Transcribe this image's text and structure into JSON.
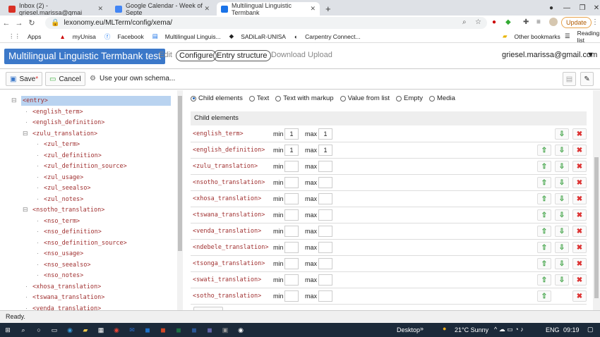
{
  "browser": {
    "tabs": [
      {
        "title": "Inbox (2) - griesel.marissa@gmai",
        "color": "#d93025"
      },
      {
        "title": "Google Calendar - Week of Septe",
        "color": "#4285f4"
      },
      {
        "title": "Multilingual Linguistic Termbank",
        "color": "#1a73e8"
      }
    ],
    "url": "lexonomy.eu/MLTerm/config/xema/",
    "update_label": "Update",
    "bookmarks": [
      "Apps",
      "myUnisa",
      "Facebook",
      "Multilingual Linguis...",
      "SADiLaR-UNISA",
      "Carpentry Connect..."
    ],
    "other_bookmarks": "Other bookmarks",
    "reading_list": "Reading list"
  },
  "app": {
    "title": "Multilingual Linguistic Termbank test",
    "menu": [
      "Edit",
      "Configure",
      "Entry structure",
      "Download",
      "Upload"
    ],
    "user": "griesel.marissa@gmail.com"
  },
  "toolbar": {
    "save": "Save",
    "cancel": "Cancel",
    "schema": "Use your own schema..."
  },
  "tree": [
    {
      "label": "<entry>",
      "depth": 0,
      "toggle": "−",
      "selected": true
    },
    {
      "label": "<english_term>",
      "depth": 1
    },
    {
      "label": "<english_definition>",
      "depth": 1
    },
    {
      "label": "<zulu_translation>",
      "depth": 1,
      "toggle": "−"
    },
    {
      "label": "<zul_term>",
      "depth": 2
    },
    {
      "label": "<zul_definition>",
      "depth": 2
    },
    {
      "label": "<zul_definition_source>",
      "depth": 2
    },
    {
      "label": "<zul_usage>",
      "depth": 2
    },
    {
      "label": "<zul_seealso>",
      "depth": 2
    },
    {
      "label": "<zul_notes>",
      "depth": 2
    },
    {
      "label": "<nsotho_translation>",
      "depth": 1,
      "toggle": "−"
    },
    {
      "label": "<nso_term>",
      "depth": 2
    },
    {
      "label": "<nso_definition>",
      "depth": 2
    },
    {
      "label": "<nso_definition_source>",
      "depth": 2
    },
    {
      "label": "<nso_usage>",
      "depth": 2
    },
    {
      "label": "<nso_seealso>",
      "depth": 2
    },
    {
      "label": "<nso_notes>",
      "depth": 2
    },
    {
      "label": "<xhosa_translation>",
      "depth": 1
    },
    {
      "label": "<tswana_translation>",
      "depth": 1
    },
    {
      "label": "<venda_translation>",
      "depth": 1
    }
  ],
  "content_types": [
    {
      "label": "Child elements",
      "selected": true
    },
    {
      "label": "Text"
    },
    {
      "label": "Text with markup"
    },
    {
      "label": "Value from list"
    },
    {
      "label": "Empty"
    },
    {
      "label": "Media"
    }
  ],
  "section_title": "Child elements",
  "min_label": "min",
  "max_label": "max",
  "children": [
    {
      "name": "<english_term>",
      "min": "1",
      "max": "1",
      "up": false,
      "down": true
    },
    {
      "name": "<english_definition>",
      "min": "1",
      "max": "1",
      "up": true,
      "down": true
    },
    {
      "name": "<zulu_translation>",
      "min": "",
      "max": "",
      "up": true,
      "down": true
    },
    {
      "name": "<nsotho_translation>",
      "min": "",
      "max": "",
      "up": true,
      "down": true
    },
    {
      "name": "<xhosa_translation>",
      "min": "",
      "max": "",
      "up": true,
      "down": true
    },
    {
      "name": "<tswana_translation>",
      "min": "",
      "max": "",
      "up": true,
      "down": true
    },
    {
      "name": "<venda_translation>",
      "min": "",
      "max": "",
      "up": true,
      "down": true
    },
    {
      "name": "<ndebele_translation>",
      "min": "",
      "max": "",
      "up": true,
      "down": true
    },
    {
      "name": "<tsonga_translation>",
      "min": "",
      "max": "",
      "up": true,
      "down": true
    },
    {
      "name": "<swati_translation>",
      "min": "",
      "max": "",
      "up": true,
      "down": true
    },
    {
      "name": "<sotho_translation>",
      "min": "",
      "max": "",
      "up": true,
      "down": false
    }
  ],
  "status": "Ready.",
  "taskbar": {
    "desktop": "Desktop",
    "weather": "21°C  Sunny",
    "lang": "ENG",
    "time": "09:19"
  }
}
